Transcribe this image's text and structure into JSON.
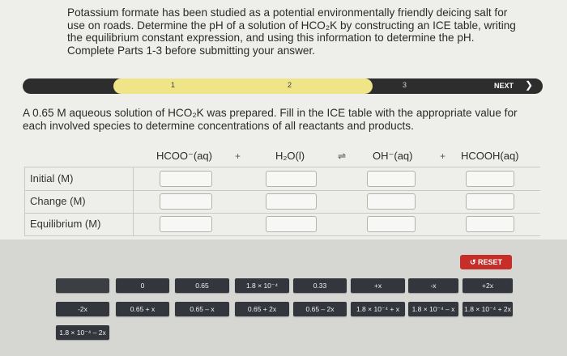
{
  "intro": "Potassium formate has been studied as a potential environmentally friendly deicing salt for use on roads. Determine the pH of a solution of HCO₂K by constructing an ICE table, writing the equilibrium constant expression, and using this information to determine the pH. Complete Parts 1-3 before submitting your answer.",
  "progress": {
    "steps": [
      "1",
      "2",
      "3"
    ],
    "next_label": "NEXT",
    "next_icon": "chevron-right-icon",
    "fill_color": "#efe488"
  },
  "question": "A 0.65 M aqueous solution of HCO₂K was prepared. Fill in the ICE table with the appropriate value for each involved species to determine concentrations of all reactants and products.",
  "table": {
    "species": [
      "HCOO⁻(aq)",
      "H₂O(l)",
      "OH⁻(aq)",
      "HCOOH(aq)"
    ],
    "operators": [
      "+",
      "⇌",
      "+"
    ],
    "rows": [
      "Initial (M)",
      "Change (M)",
      "Equilibrium (M)"
    ]
  },
  "reset_label": "RESET",
  "reset_icon": "undo-icon",
  "tiles": [
    "",
    "0",
    "0.65",
    "1.8 × 10⁻⁴",
    "0.33",
    "+x",
    "-x",
    "+2x",
    "-2x",
    "0.65 + x",
    "0.65 – x",
    "0.65 + 2x",
    "0.65 – 2x",
    "1.8 × 10⁻⁴ + x",
    "1.8 × 10⁻⁴ – x",
    "1.8 × 10⁻⁴ + 2x",
    "1.8 × 10⁻⁴ – 2x"
  ]
}
